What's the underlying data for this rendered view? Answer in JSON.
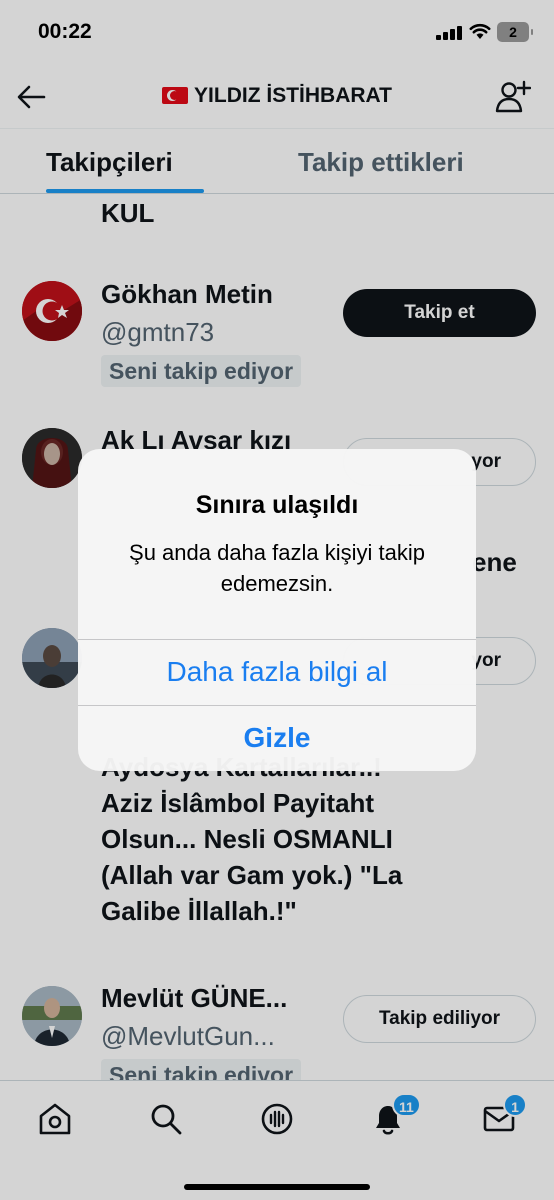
{
  "status_bar": {
    "time": "00:22",
    "battery": "2"
  },
  "header": {
    "title": "YILDIZ İSTİHBARAT",
    "flag_icon": "turkey-flag-icon",
    "back_icon": "arrow-left-icon",
    "add_user_icon": "add-user-icon"
  },
  "tabs": [
    {
      "label": "Takipçileri",
      "active": true
    },
    {
      "label": "Takip ettikleri",
      "active": false
    }
  ],
  "list": {
    "row0_tail": "KUL",
    "row1": {
      "name": "Gökhan Metin",
      "handle": "@gmtn73",
      "badge": "Seni takip ediyor",
      "button": "Takip et"
    },
    "row2": {
      "name": "Ak Lı Avsar kızı",
      "button_partial": "yor",
      "bio_partial": "ene"
    },
    "row3": {
      "button_partial": "yor",
      "bio_lines": [
        "Aydosya Kartallarılar..!",
        "Aziz İslâmbol Payitaht",
        "Olsun... Nesli OSMANLI",
        "(Allah var Gam yok.) \"La",
        "Galibe İllallah.!\""
      ]
    },
    "row4": {
      "name": "Mevlüt GÜNE...",
      "handle": "@MevlutGun...",
      "badge": "Seni takip ediyor",
      "button": "Takip ediliyor"
    }
  },
  "alert": {
    "title": "Sınıra ulaşıldı",
    "message": "Şu anda daha fazla kişiyi takip edemezsin.",
    "primary_button": "Daha fazla bilgi al",
    "secondary_button": "Gizle"
  },
  "tabbar": {
    "items": [
      "home-icon",
      "search-icon",
      "spaces-icon",
      "notifications-icon",
      "messages-icon"
    ],
    "notifications_count": "11",
    "messages_count": "1"
  },
  "colors": {
    "accent": "#1d9bf0",
    "alert_button": "#1a7ef0"
  }
}
